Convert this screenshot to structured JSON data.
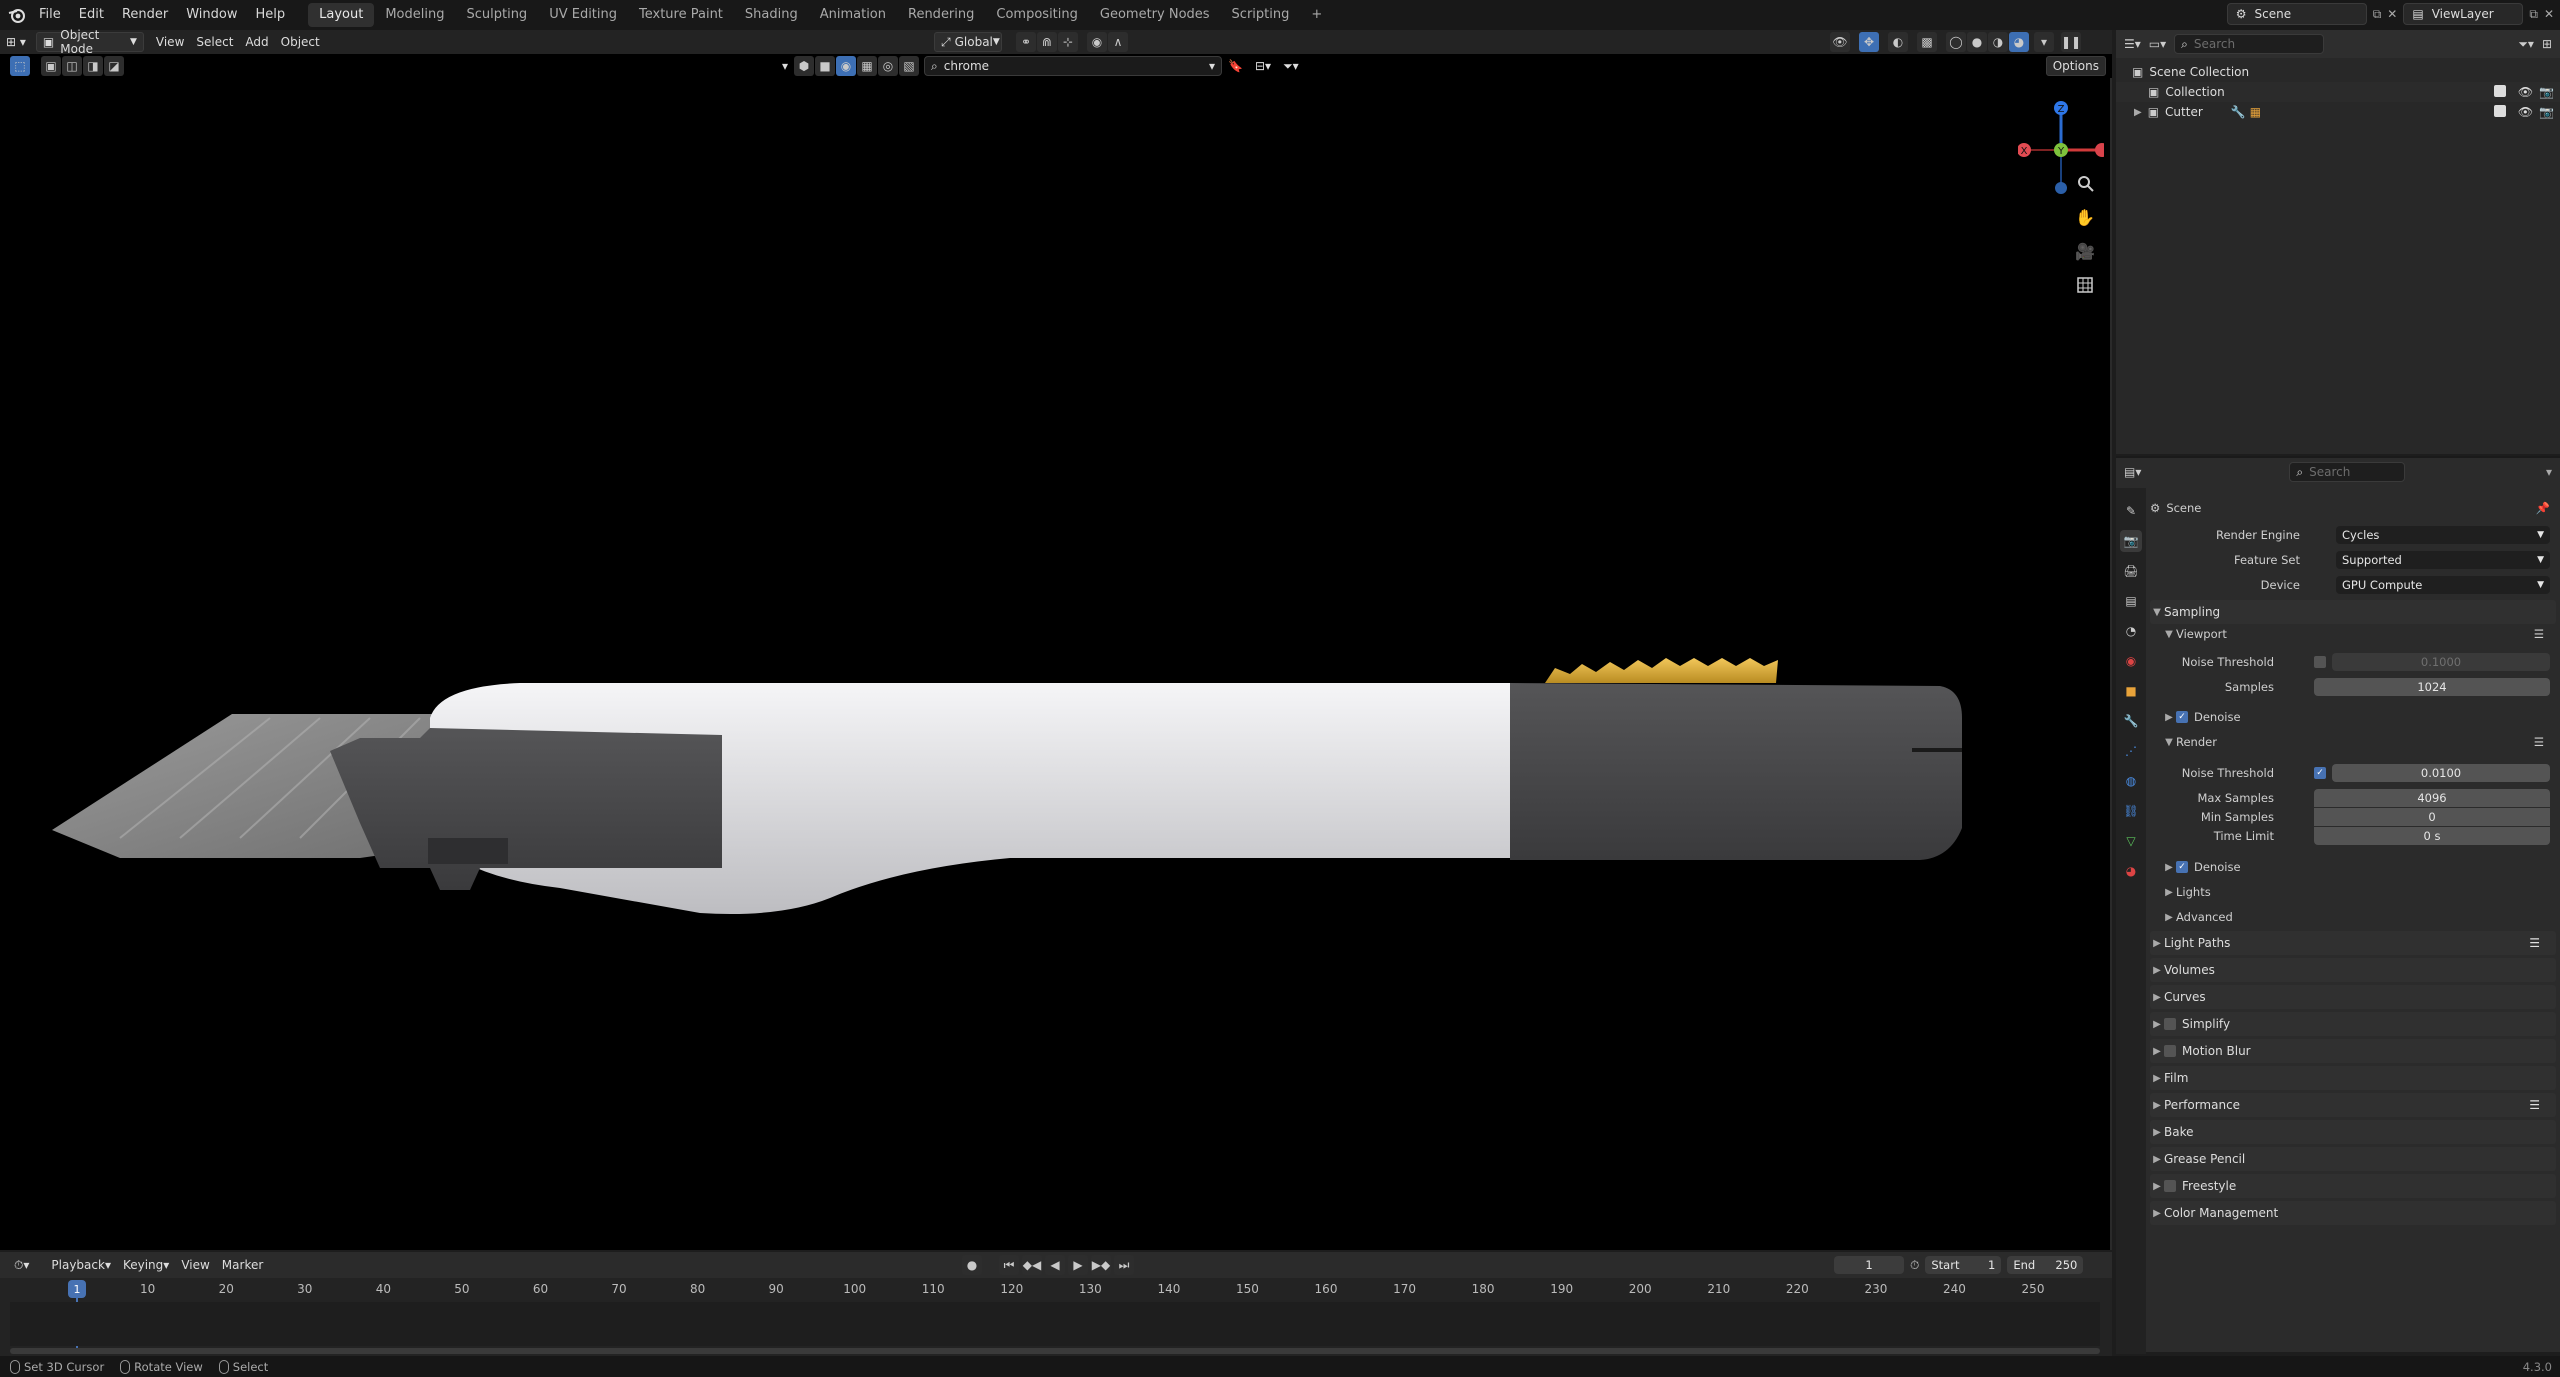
{
  "menu": {
    "items": [
      "File",
      "Edit",
      "Render",
      "Window",
      "Help"
    ]
  },
  "workspaces": [
    "Layout",
    "Modeling",
    "Sculpting",
    "UV Editing",
    "Texture Paint",
    "Shading",
    "Animation",
    "Rendering",
    "Compositing",
    "Geometry Nodes",
    "Scripting"
  ],
  "active_workspace": "Layout",
  "top_right": {
    "scene": "Scene",
    "view_layer": "ViewLayer"
  },
  "viewport": {
    "mode": "Object Mode",
    "menus": [
      "View",
      "Select",
      "Add",
      "Object"
    ],
    "transform_orientation": "Global",
    "search_value": "chrome",
    "options_label": "Options",
    "gizmo_labels": {
      "z": "Z",
      "y": "Y",
      "x": "X"
    }
  },
  "outliner": {
    "search_placeholder": "Search",
    "rows": [
      {
        "label": "Scene Collection"
      },
      {
        "label": "Collection"
      },
      {
        "label": "Cutter"
      }
    ]
  },
  "properties": {
    "search_placeholder": "Search",
    "context": "Scene",
    "render_engine_label": "Render Engine",
    "render_engine": "Cycles",
    "feature_set_label": "Feature Set",
    "feature_set": "Supported",
    "device_label": "Device",
    "device": "GPU Compute",
    "sampling": "Sampling",
    "viewport_section": "Viewport",
    "noise_threshold_label": "Noise Threshold",
    "viewport_noise_threshold": "0.1000",
    "samples_label": "Samples",
    "viewport_samples": "1024",
    "denoise_label": "Denoise",
    "render_section": "Render",
    "render_noise_threshold": "0.0100",
    "max_samples_label": "Max Samples",
    "max_samples": "4096",
    "min_samples_label": "Min Samples",
    "min_samples": "0",
    "time_limit_label": "Time Limit",
    "time_limit": "0 s",
    "lights": "Lights",
    "advanced": "Advanced",
    "panels": [
      "Light Paths",
      "Volumes",
      "Curves",
      "Simplify",
      "Motion Blur",
      "Film",
      "Performance",
      "Bake",
      "Grease Pencil",
      "Freestyle",
      "Color Management"
    ]
  },
  "timeline": {
    "menus": [
      "Playback",
      "Keying",
      "View",
      "Marker"
    ],
    "current_frame": "1",
    "start_label": "Start",
    "start": "1",
    "end_label": "End",
    "end": "250",
    "ticks": [
      "10",
      "20",
      "30",
      "40",
      "50",
      "60",
      "70",
      "80",
      "90",
      "100",
      "110",
      "120",
      "130",
      "140",
      "150",
      "160",
      "170",
      "180",
      "190",
      "200",
      "210",
      "220",
      "230",
      "240",
      "250"
    ]
  },
  "statusbar": {
    "items": [
      "Set 3D Cursor",
      "Rotate View",
      "Select"
    ],
    "version": "4.3.0"
  },
  "colors": {
    "accent": "#4772b3",
    "handle_white": "#e4e4e6",
    "handle_dark": "#444446",
    "slider_gold": "#e0b23a",
    "blade_grey": "#8f8f8f"
  }
}
